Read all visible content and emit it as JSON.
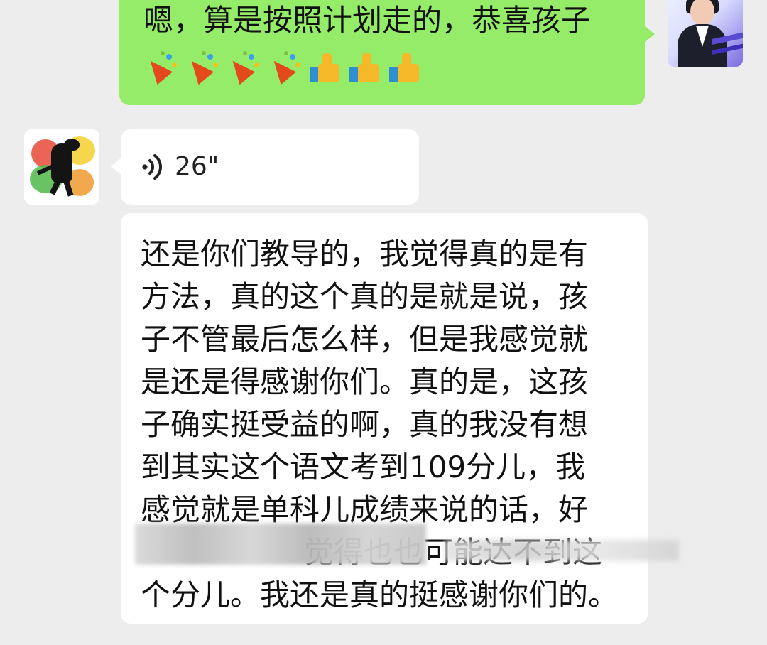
{
  "sent_message": {
    "text": "嗯，算是按照计划走的，恭喜孩子",
    "emojis": [
      "party-popper",
      "party-popper",
      "party-popper",
      "party-popper",
      "thumbs-up",
      "thumbs-up",
      "thumbs-up"
    ]
  },
  "voice_message": {
    "duration": "26\""
  },
  "transcription": {
    "lines": [
      "还是你们教导的，我觉得真的是有",
      "方法，真的这个真的是就是说，孩",
      "子不管最后怎么样，但是我感觉就",
      "是还是得感谢你们。真的是，这孩",
      "子确实挺受益的啊，真的我没有想",
      "到其实这个语文考到109分儿，我",
      "感觉就是单科儿成绩来说的话，好",
      "觉得也也可能达不到这",
      "个分儿。我还是真的挺感谢你们的。"
    ]
  },
  "colors": {
    "background": "#ededed",
    "sent_bubble": "#95ec69",
    "received_bubble": "#ffffff"
  }
}
